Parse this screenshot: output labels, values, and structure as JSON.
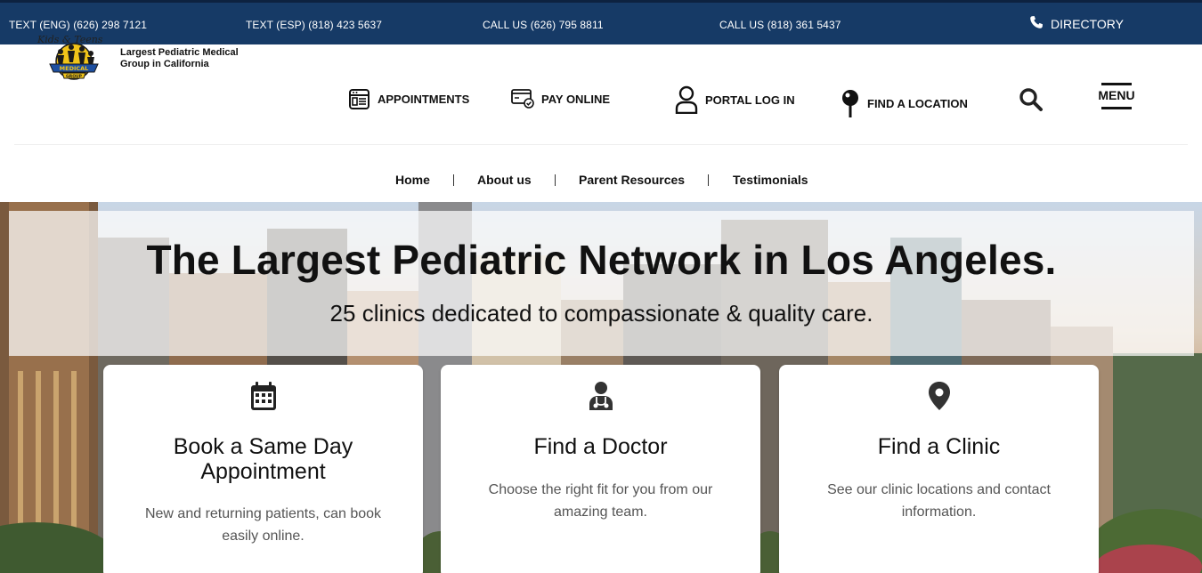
{
  "topbar": {
    "text_eng": "TEXT (ENG) (626) 298 7121",
    "text_esp": "TEXT (ESP) (818) 423 5637",
    "call_1": "CALL US (626) 795 8811",
    "call_2": "CALL US (818) 361 5437",
    "directory": "DIRECTORY",
    "background_color": "#163a66"
  },
  "header": {
    "tagline": "Largest Pediatric Medical Group in California",
    "nav": {
      "appointments": "APPOINTMENTS",
      "pay_online": "PAY ONLINE",
      "portal_login": "PORTAL LOG IN",
      "find_location": "FIND A LOCATION",
      "menu": "MENU"
    }
  },
  "subnav": {
    "items": [
      "Home",
      "About us",
      "Parent Resources",
      "Testimonials"
    ]
  },
  "hero": {
    "title": "The Largest Pediatric Network in Los Angeles.",
    "subtitle": "25 clinics dedicated to compassionate & quality care."
  },
  "cards": [
    {
      "icon": "calendar-icon",
      "title": "Book a Same Day Appointment",
      "description": "New and returning patients, can book easily online."
    },
    {
      "icon": "doctor-icon",
      "title": "Find a Doctor",
      "description": "Choose the right fit for you from our amazing team."
    },
    {
      "icon": "map-pin-icon",
      "title": "Find a Clinic",
      "description": "See our clinic locations and contact information."
    }
  ]
}
